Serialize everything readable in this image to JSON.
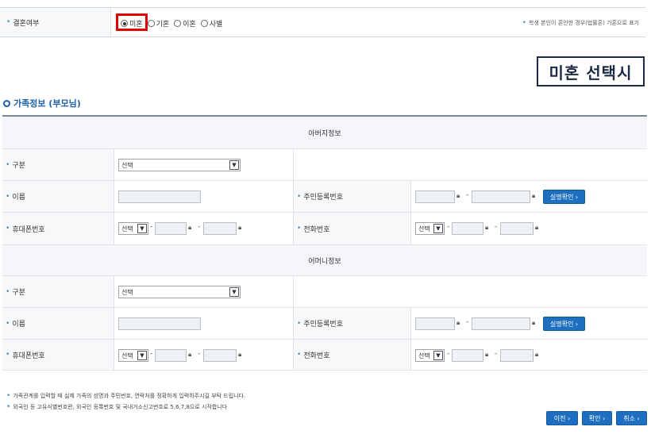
{
  "marital": {
    "label": "결혼여부",
    "options": [
      "미혼",
      "기혼",
      "이혼",
      "사별"
    ],
    "selected": "미혼",
    "note": "학생 본인이 혼인한 경우(법률혼) 기혼으로 표기"
  },
  "callout": "미혼 선택시",
  "section_title": "가족정보 (부모님)",
  "father": {
    "header": "아버지정보",
    "category_label": "구분",
    "category_value": "선택",
    "name_label": "이름",
    "rrn_label": "주민등록번호",
    "verify_button": "실명확인",
    "mobile_label": "휴대폰번호",
    "mobile_prefix": "선택",
    "phone_label": "전화번호",
    "phone_prefix": "선택"
  },
  "mother": {
    "header": "어머니정보",
    "category_label": "구분",
    "category_value": "선택",
    "name_label": "이름",
    "rrn_label": "주민등록번호",
    "verify_button": "실명확인",
    "mobile_label": "휴대폰번호",
    "mobile_prefix": "선택",
    "phone_label": "전화번호",
    "phone_prefix": "선택"
  },
  "notes": [
    "가족관계를 입력할 때 실제 가족의 성명과 주민번호, 연락처를 정확하게 입력하주시길 부탁 드립니다.",
    "외국인 등 고유식별번호란, 외국인 등록번호 및 국내거소신고번호로 5,6,7,8으로 시작합니다"
  ],
  "buttons": {
    "prev": "이전",
    "confirm": "확인",
    "cancel": "취소"
  },
  "dash": "-",
  "chevron": "›",
  "colors": {
    "accent": "#1f6fc0",
    "highlight": "#e00000"
  }
}
